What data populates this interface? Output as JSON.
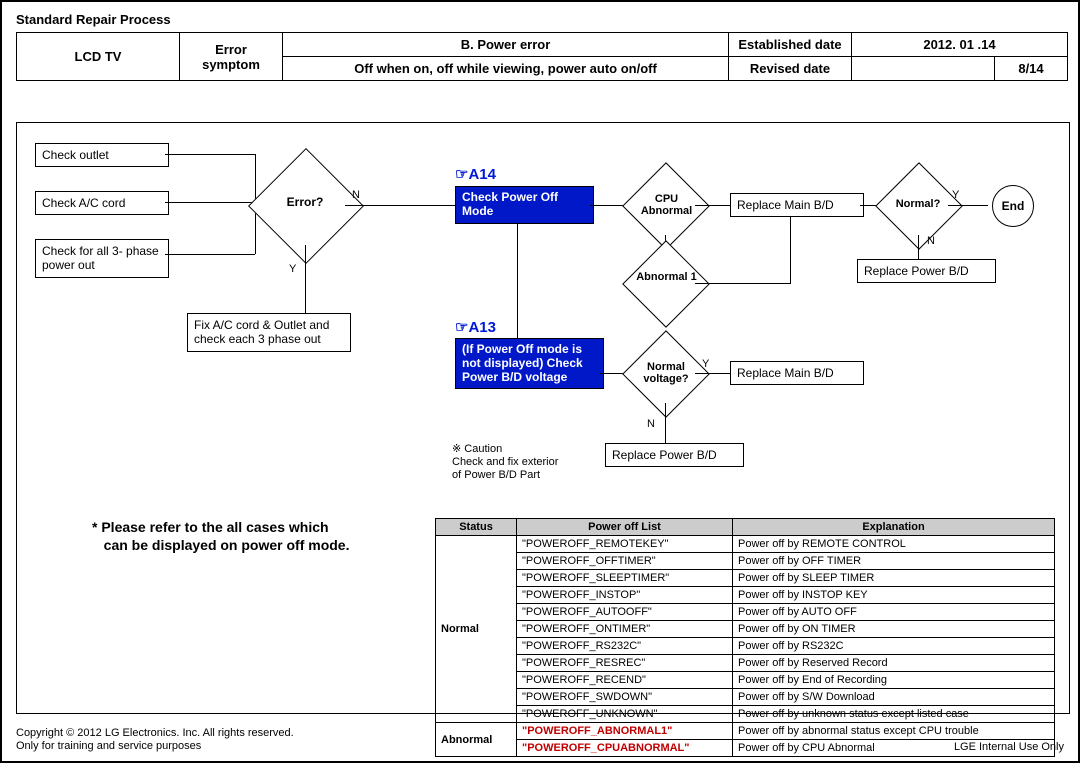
{
  "doc_title": "Standard Repair Process",
  "header": {
    "product": "LCD  TV",
    "symptom_label": "Error symptom",
    "title": "B. Power error",
    "est_label": "Established date",
    "est_date": "2012. 01 .14",
    "symptom_detail": "Off when on, off while viewing, power auto on/off",
    "rev_label": "Revised date",
    "rev_date": "",
    "page": "8/14"
  },
  "refs": {
    "a14": "☞A14",
    "a13": "☞A13"
  },
  "boxes": {
    "check_outlet": "Check outlet",
    "check_ac": "Check A/C cord",
    "check_3ph": "Check for all 3- phase power out",
    "fix": "Fix A/C cord & Outlet and check each 3 phase out",
    "check_poff": "Check Power Off Mode",
    "replace_main1": "Replace Main B/D",
    "replace_power1": "Replace Power B/D",
    "if_poff": "(If Power Off mode is not displayed) Check Power B/D voltage",
    "replace_main2": "Replace Main B/D",
    "replace_power2": "Replace Power B/D",
    "end": "End"
  },
  "diamonds": {
    "error": "Error?",
    "cpu": "CPU Abnormal",
    "ab1": "Abnormal 1",
    "normalv": "Normal voltage?",
    "normal": "Normal?"
  },
  "edge_labels": {
    "n": "N",
    "y": "Y"
  },
  "caution": {
    "star": "※ Caution",
    "l1": "Check and fix exterior",
    "l2": "of Power B/D Part"
  },
  "note": {
    "l1": "*  Please refer to the all cases which",
    "l2": "can be displayed on power off mode."
  },
  "table": {
    "h1": "Status",
    "h2": "Power off List",
    "h3": "Explanation",
    "status_normal": "Normal",
    "status_abnormal": "Abnormal",
    "rows_normal": [
      {
        "code": "\"POWEROFF_REMOTEKEY\"",
        "exp": "Power off by REMOTE CONTROL"
      },
      {
        "code": "\"POWEROFF_OFFTIMER\"",
        "exp": "Power off by OFF TIMER"
      },
      {
        "code": "\"POWEROFF_SLEEPTIMER\"",
        "exp": "Power off by SLEEP TIMER"
      },
      {
        "code": "\"POWEROFF_INSTOP\"",
        "exp": "Power off by INSTOP KEY"
      },
      {
        "code": "\"POWEROFF_AUTOOFF\"",
        "exp": "Power off  by AUTO OFF"
      },
      {
        "code": "\"POWEROFF_ONTIMER\"",
        "exp": "Power off by ON TIMER"
      },
      {
        "code": "\"POWEROFF_RS232C\"",
        "exp": "Power off by RS232C"
      },
      {
        "code": "\"POWEROFF_RESREC\"",
        "exp": "Power off by Reserved Record"
      },
      {
        "code": "\"POWEROFF_RECEND\"",
        "exp": "Power off by End of Recording"
      },
      {
        "code": "\"POWEROFF_SWDOWN\"",
        "exp": "Power off by S/W Download"
      },
      {
        "code": "\"POWEROFF_UNKNOWN\"",
        "exp": "Power off by unknown status except listed case"
      }
    ],
    "rows_abnormal": [
      {
        "code": "\"POWEROFF_ABNORMAL1\"",
        "exp": "Power off by abnormal status except CPU trouble"
      },
      {
        "code": "\"POWEROFF_CPUABNORMAL\"",
        "exp": "Power off by CPU Abnormal"
      }
    ]
  },
  "footer": {
    "l1": "Copyright © 2012 LG Electronics. Inc. All rights reserved.",
    "l2": "Only for training and service purposes",
    "r": "LGE Internal Use Only"
  }
}
